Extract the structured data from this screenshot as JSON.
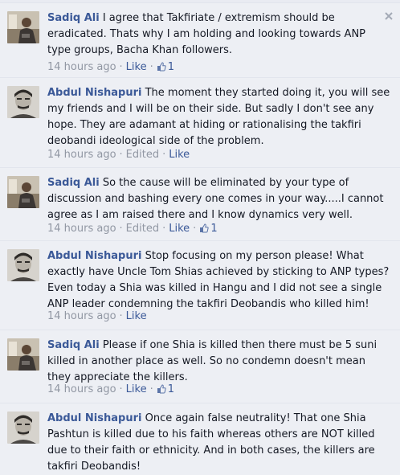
{
  "close_icon": "close-icon",
  "comments": [
    {
      "author": "Sadiq Ali",
      "body": "I agree that Takfiriate / extremism should be eradicated. Thats why I am holding and looking towards ANP type groups, Bacha Khan followers.",
      "time": "14 hours ago",
      "edited": "",
      "like": "Like",
      "likes": "1",
      "avatar": "photo-avatar"
    },
    {
      "author": "Abdul Nishapuri",
      "body": "The moment they started doing it, you will see my friends and I will be on their side. But sadly I don't see any hope. They are adamant at hiding or rationalising the takfiri deobandi ideological side of the problem.",
      "time": "14 hours ago",
      "edited": "Edited",
      "like": "Like",
      "likes": "",
      "avatar": "portrait-avatar"
    },
    {
      "author": "Sadiq Ali",
      "body": "So the cause will be eliminated by your type of discussion and bashing every one comes in your way.....I cannot agree as I am raised there and I know dynamics very well.",
      "time": "14 hours ago",
      "edited": "Edited",
      "like": "Like",
      "likes": "1",
      "avatar": "photo-avatar"
    },
    {
      "author": "Abdul Nishapuri",
      "body": "Stop focusing on my person please! What exactly have Uncle Tom Shias achieved by sticking to ANP types? Even today a Shia was killed in Hangu and I did not see a single ANP leader condemning the takfiri Deobandis who killed him!",
      "time": "14 hours ago",
      "edited": "",
      "like": "Like",
      "likes": "",
      "avatar": "portrait-avatar"
    },
    {
      "author": "Sadiq Ali",
      "body": "Please if one Shia is killed then there must be 5 suni killed in another place as well. So no condemn doesn't mean they appreciate the killers.",
      "time": "14 hours ago",
      "edited": "",
      "like": "Like",
      "likes": "1",
      "avatar": "photo-avatar"
    },
    {
      "author": "Abdul Nishapuri",
      "body": "Once again false neutrality! That one Shia Pashtun is killed due to his faith whereas others are NOT killed due to their faith or ethnicity. And in both cases, the killers are takfiri Deobandis!",
      "time": "",
      "edited": "",
      "like": "",
      "likes": "",
      "avatar": "portrait-avatar"
    }
  ]
}
